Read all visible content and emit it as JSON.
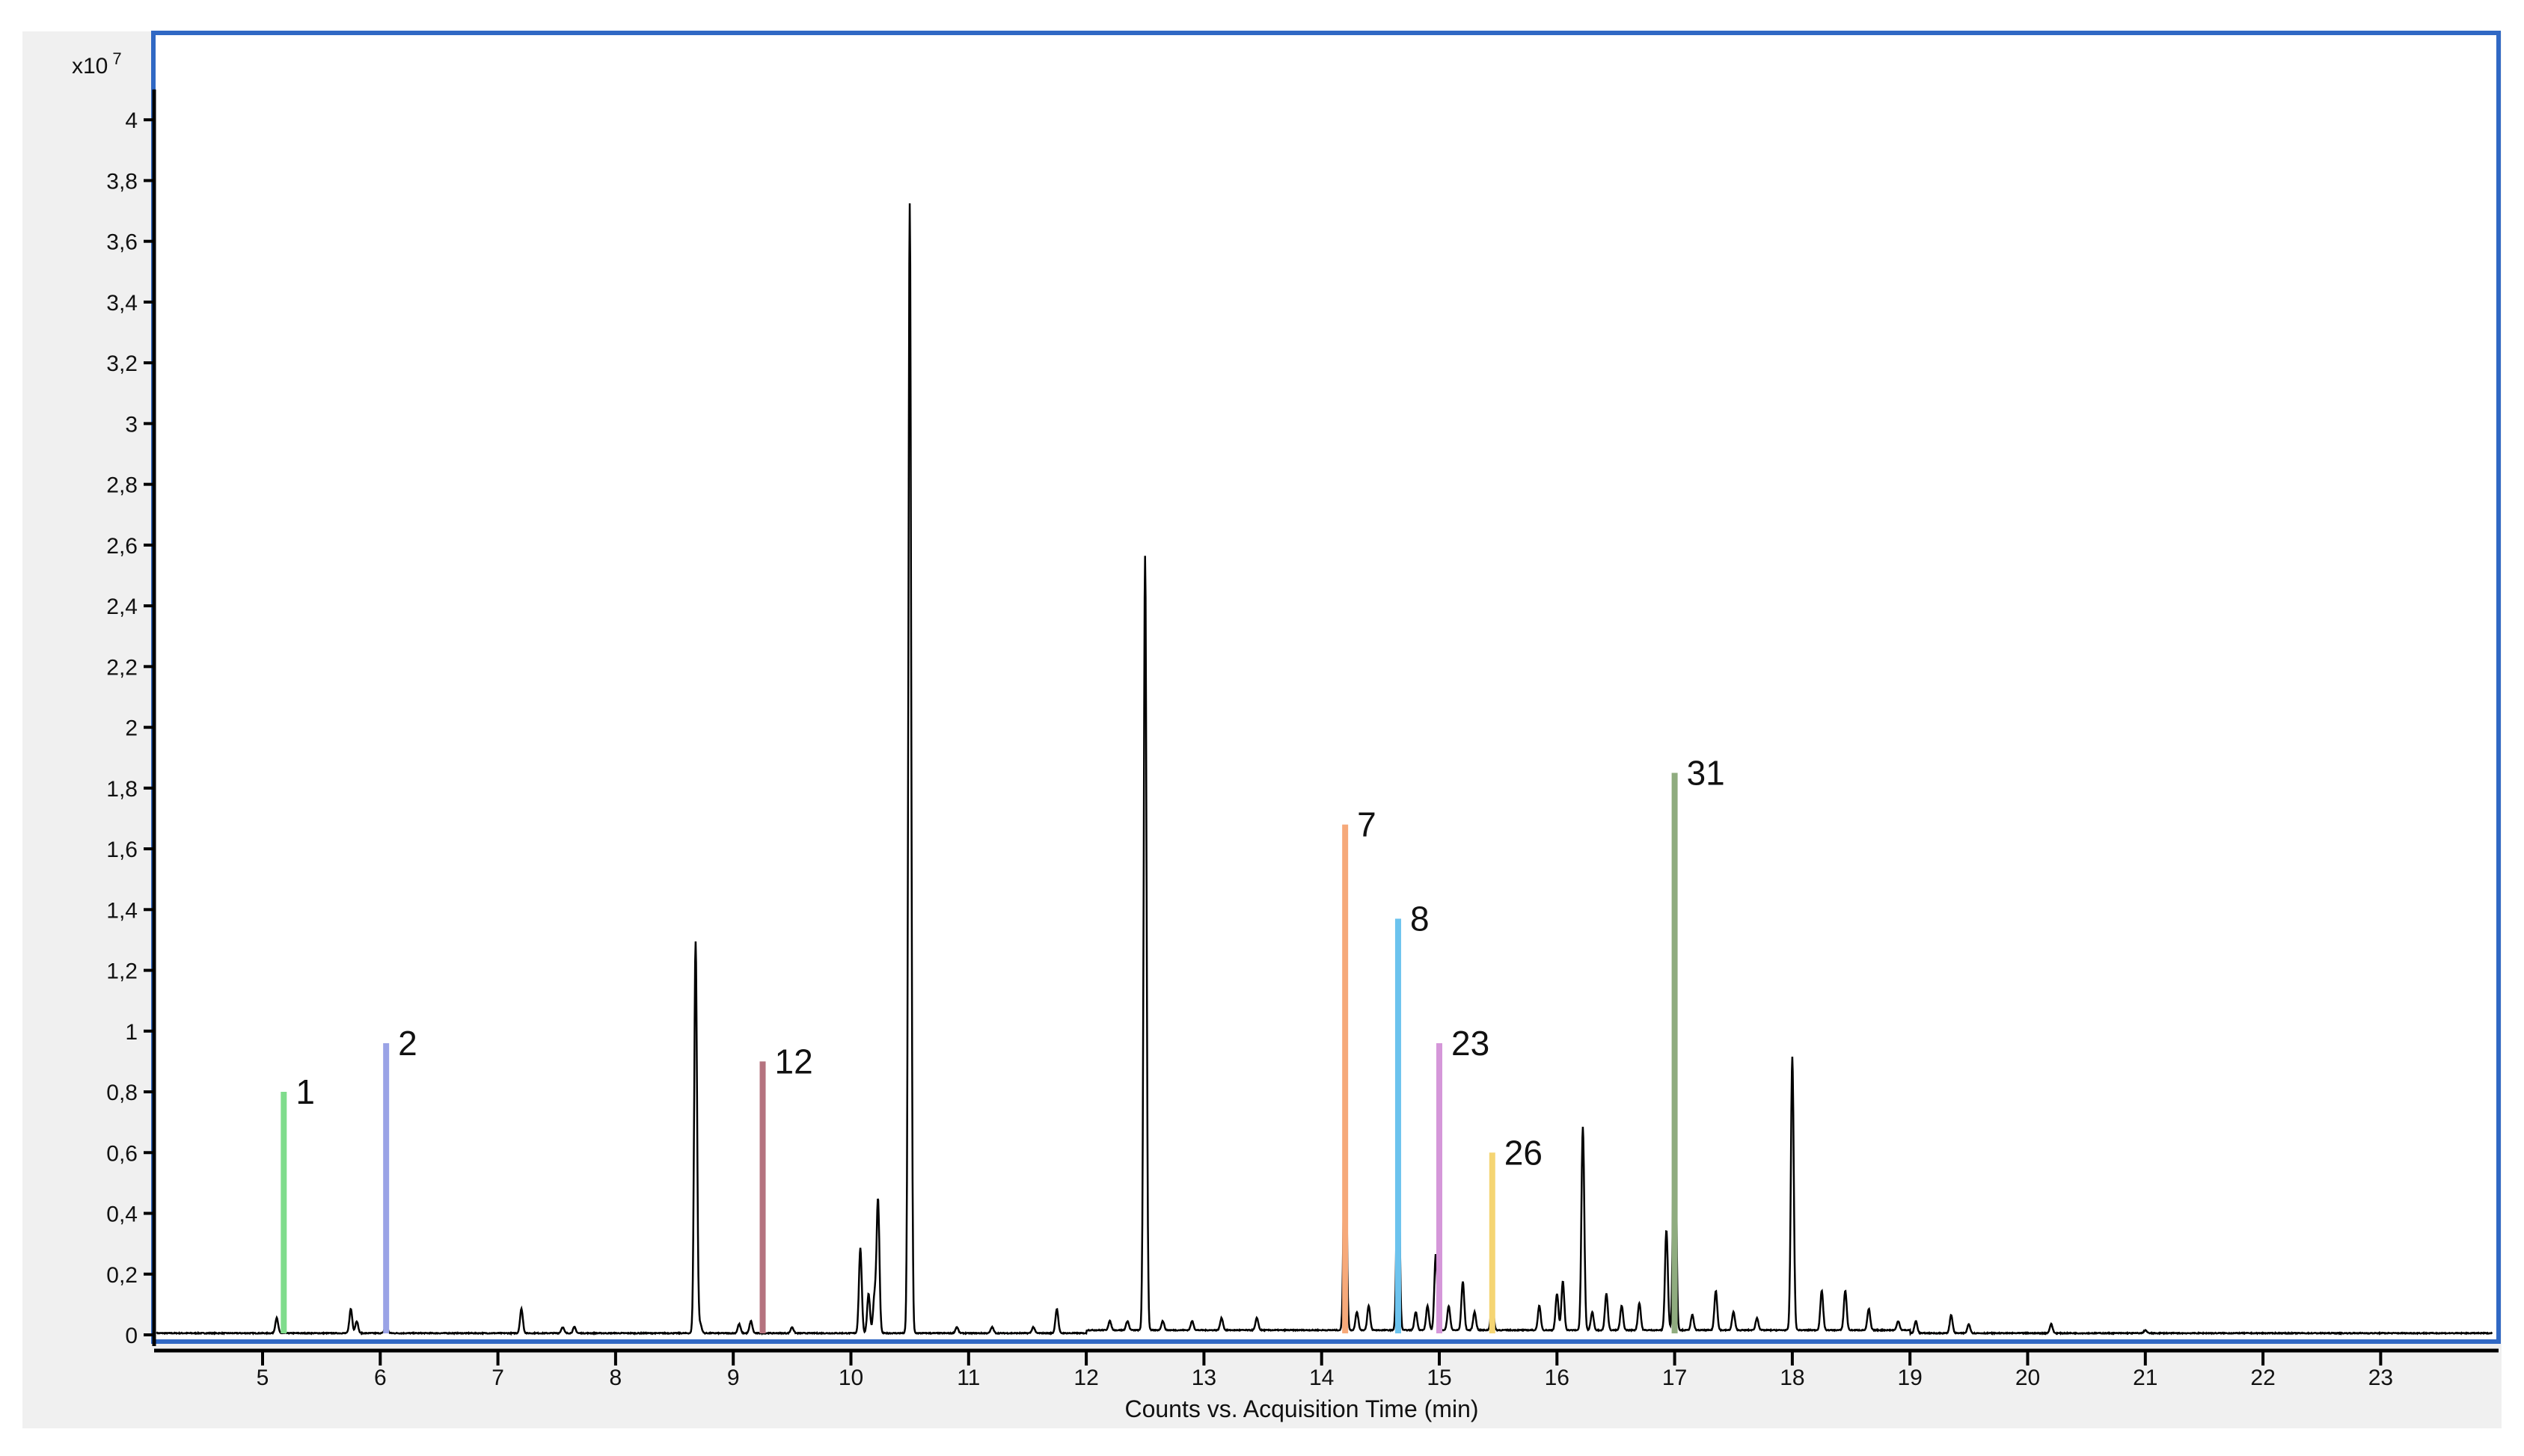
{
  "chart_data": {
    "type": "line",
    "title": "",
    "xlabel": "Counts vs. Acquisition Time (min)",
    "ylabel": "",
    "y_multiplier": "x10",
    "y_multiplier_exp": "7",
    "xlim": [
      4.07,
      24.0
    ],
    "ylim": [
      0,
      4.1
    ],
    "x_ticks": [
      5,
      6,
      7,
      8,
      9,
      10,
      11,
      12,
      13,
      14,
      15,
      16,
      17,
      18,
      19,
      20,
      21,
      22,
      23
    ],
    "y_ticks": [
      {
        "v": 0,
        "label": "0"
      },
      {
        "v": 0.2,
        "label": "0,2"
      },
      {
        "v": 0.4,
        "label": "0,4"
      },
      {
        "v": 0.6,
        "label": "0,6"
      },
      {
        "v": 0.8,
        "label": "0,8"
      },
      {
        "v": 1,
        "label": "1"
      },
      {
        "v": 1.2,
        "label": "1,2"
      },
      {
        "v": 1.4,
        "label": "1,4"
      },
      {
        "v": 1.6,
        "label": "1,6"
      },
      {
        "v": 1.8,
        "label": "1,8"
      },
      {
        "v": 2,
        "label": "2"
      },
      {
        "v": 2.2,
        "label": "2,2"
      },
      {
        "v": 2.4,
        "label": "2,4"
      },
      {
        "v": 2.6,
        "label": "2,6"
      },
      {
        "v": 2.8,
        "label": "2,8"
      },
      {
        "v": 3,
        "label": "3"
      },
      {
        "v": 3.2,
        "label": "3,2"
      },
      {
        "v": 3.4,
        "label": "3,4"
      },
      {
        "v": 3.6,
        "label": "3,6"
      },
      {
        "v": 3.8,
        "label": "3,8"
      },
      {
        "v": 4,
        "label": "4"
      }
    ],
    "grid": false,
    "trace_peaks": [
      [
        5.12,
        0.05
      ],
      [
        5.75,
        0.08
      ],
      [
        5.8,
        0.04
      ],
      [
        6.05,
        0.03
      ],
      [
        7.2,
        0.08
      ],
      [
        7.55,
        0.02
      ],
      [
        7.65,
        0.02
      ],
      [
        8.68,
        1.29
      ],
      [
        8.72,
        0.03
      ],
      [
        9.05,
        0.03
      ],
      [
        9.15,
        0.04
      ],
      [
        9.5,
        0.02
      ],
      [
        10.08,
        0.28
      ],
      [
        10.15,
        0.13
      ],
      [
        10.2,
        0.12
      ],
      [
        10.23,
        0.44
      ],
      [
        10.5,
        3.72
      ],
      [
        10.9,
        0.02
      ],
      [
        11.2,
        0.02
      ],
      [
        11.55,
        0.02
      ],
      [
        11.75,
        0.08
      ],
      [
        12.2,
        0.03
      ],
      [
        12.35,
        0.03
      ],
      [
        12.5,
        2.55
      ],
      [
        12.65,
        0.03
      ],
      [
        12.9,
        0.03
      ],
      [
        13.15,
        0.04
      ],
      [
        13.45,
        0.04
      ],
      [
        14.2,
        0.8
      ],
      [
        14.3,
        0.06
      ],
      [
        14.4,
        0.08
      ],
      [
        14.65,
        0.71
      ],
      [
        14.8,
        0.06
      ],
      [
        14.9,
        0.08
      ],
      [
        14.97,
        0.25
      ],
      [
        15.08,
        0.08
      ],
      [
        15.2,
        0.16
      ],
      [
        15.3,
        0.06
      ],
      [
        15.45,
        0.1
      ],
      [
        15.85,
        0.08
      ],
      [
        16.0,
        0.12
      ],
      [
        16.05,
        0.16
      ],
      [
        16.22,
        0.67
      ],
      [
        16.3,
        0.06
      ],
      [
        16.42,
        0.12
      ],
      [
        16.55,
        0.08
      ],
      [
        16.7,
        0.09
      ],
      [
        16.93,
        0.33
      ],
      [
        17.0,
        0.97
      ],
      [
        17.15,
        0.05
      ],
      [
        17.35,
        0.13
      ],
      [
        17.5,
        0.06
      ],
      [
        17.7,
        0.04
      ],
      [
        18.0,
        0.9
      ],
      [
        18.25,
        0.13
      ],
      [
        18.45,
        0.13
      ],
      [
        18.65,
        0.07
      ],
      [
        18.9,
        0.03
      ],
      [
        19.05,
        0.04
      ],
      [
        19.35,
        0.06
      ],
      [
        19.5,
        0.03
      ],
      [
        20.2,
        0.03
      ],
      [
        21.0,
        0.01
      ]
    ],
    "series": [
      {
        "name": "1",
        "x": 5.18,
        "y": 0.8,
        "color": "#7fdc8c"
      },
      {
        "name": "2",
        "x": 6.05,
        "y": 0.96,
        "color": "#9aa3e6"
      },
      {
        "name": "12",
        "x": 9.25,
        "y": 0.9,
        "color": "#b5737f"
      },
      {
        "name": "7",
        "x": 14.2,
        "y": 1.68,
        "color": "#f6a97a"
      },
      {
        "name": "8",
        "x": 14.65,
        "y": 1.37,
        "color": "#6cc3ee"
      },
      {
        "name": "23",
        "x": 15.0,
        "y": 0.96,
        "color": "#d597d9"
      },
      {
        "name": "26",
        "x": 15.45,
        "y": 0.6,
        "color": "#f5d573"
      },
      {
        "name": "31",
        "x": 17.0,
        "y": 1.85,
        "color": "#8fac7f"
      }
    ],
    "colors": {
      "frame": "#3068c4",
      "panel": "#f0f0f0",
      "trace": "#000000"
    }
  }
}
